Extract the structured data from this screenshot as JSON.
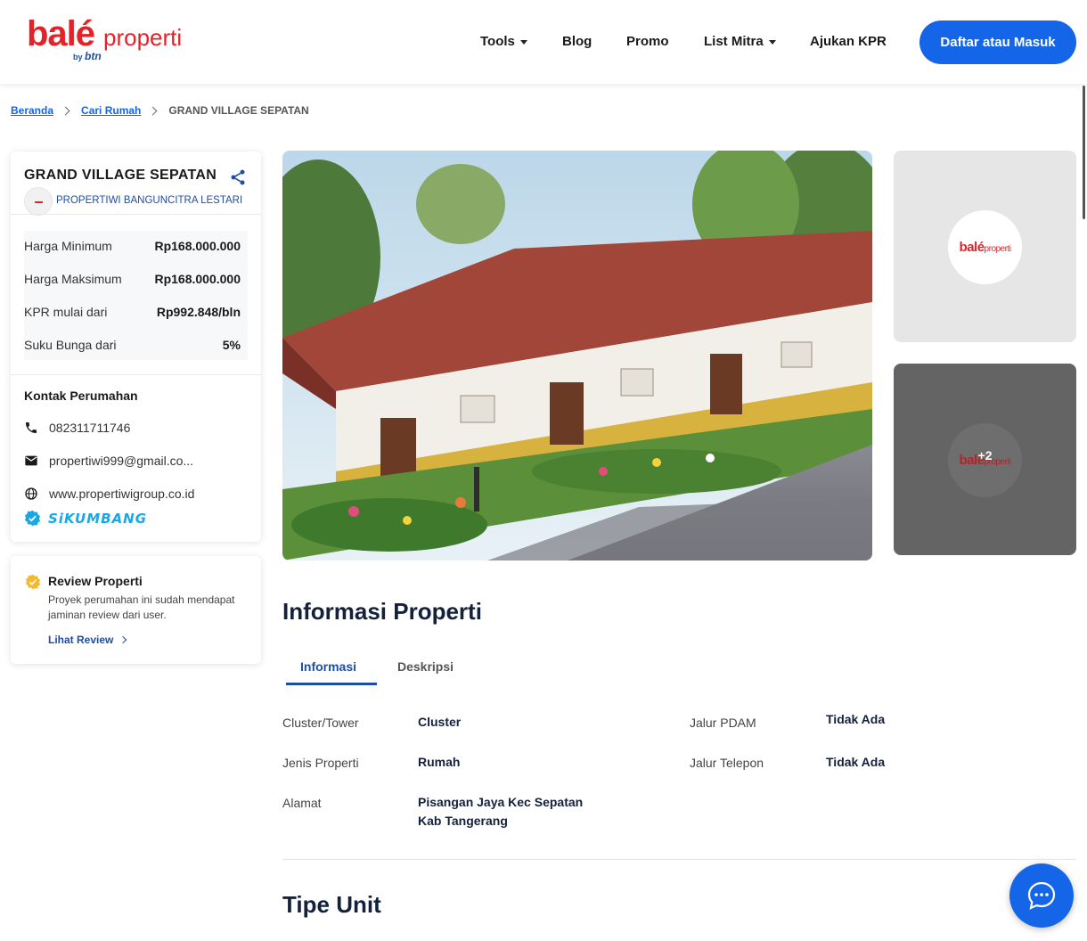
{
  "header": {
    "logo": {
      "brand": "balé",
      "product": "properti",
      "by": "by",
      "bank": "btn"
    },
    "nav": {
      "tools": "Tools",
      "blog": "Blog",
      "promo": "Promo",
      "list_mitra": "List Mitra",
      "ajukan_kpr": "Ajukan KPR"
    },
    "cta": "Daftar atau Masuk"
  },
  "breadcrumb": {
    "home": "Beranda",
    "search": "Cari Rumah",
    "current": "GRAND VILLAGE SEPATAN"
  },
  "property": {
    "title": "GRAND VILLAGE SEPATAN",
    "developer": "PROPERTIWI BANGUNCITRA LESTARI",
    "prices": [
      {
        "label": "Harga Minimum",
        "value": "Rp168.000.000"
      },
      {
        "label": "Harga Maksimum",
        "value": "Rp168.000.000"
      },
      {
        "label": "KPR mulai dari",
        "value": "Rp992.848/bln"
      },
      {
        "label": "Suku Bunga dari",
        "value": "5%"
      }
    ],
    "contact": {
      "title": "Kontak Perumahan",
      "phone": "082311711746",
      "email": "propertiwi999@gmail.co...",
      "website": "www.propertiwigroup.co.id",
      "badge": "SiKUMBANG"
    }
  },
  "review": {
    "title": "Review Properti",
    "desc": "Proyek perumahan ini sudah mendapat jaminan review dari user.",
    "link": "Lihat Review"
  },
  "gallery": {
    "more_count": "+2"
  },
  "info": {
    "heading": "Informasi Properti",
    "tabs": {
      "informasi": "Informasi",
      "deskripsi": "Deskripsi"
    },
    "left": [
      {
        "label": "Cluster/Tower",
        "value": "Cluster"
      },
      {
        "label": "Jenis Properti",
        "value": "Rumah"
      },
      {
        "label": "Alamat",
        "value": "Pisangan Jaya Kec Sepatan\nKab Tangerang"
      }
    ],
    "right": [
      {
        "label": "Jalur PDAM",
        "value": "Tidak Ada"
      },
      {
        "label": "Jalur Telepon",
        "value": "Tidak Ada"
      }
    ]
  },
  "tipe_unit": {
    "heading": "Tipe Unit"
  },
  "colors": {
    "primary": "#1565e8",
    "brand_red": "#e2232a",
    "navy": "#14213d"
  }
}
